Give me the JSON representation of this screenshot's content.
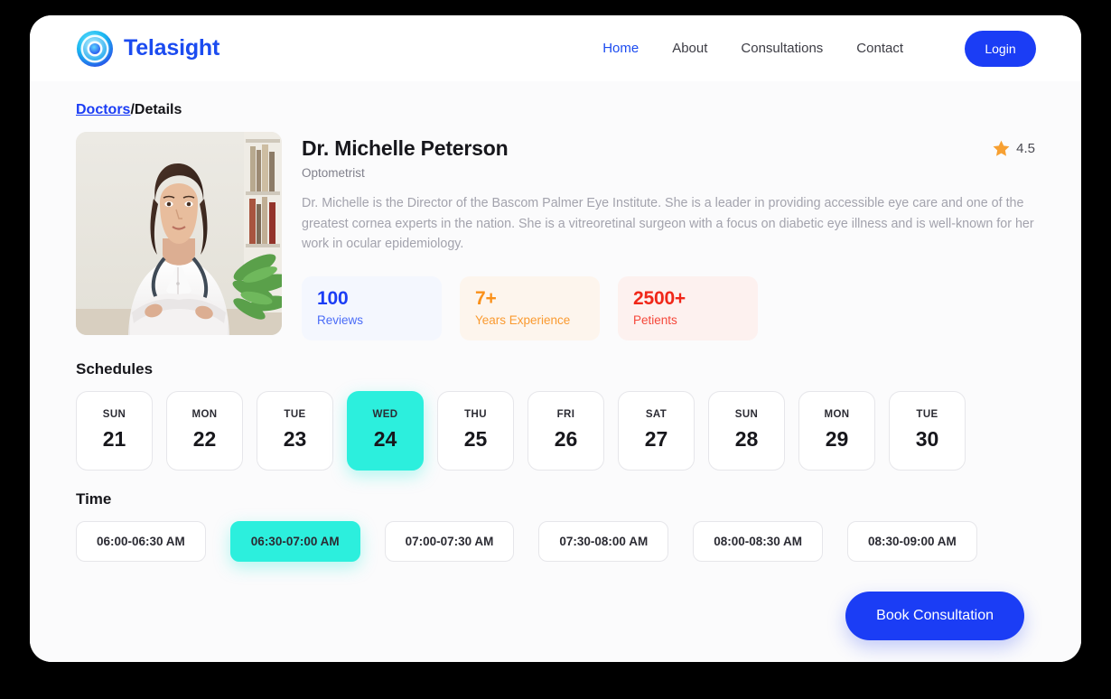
{
  "header": {
    "brand_name": "Telasight",
    "logo_icon": "concentric-circles-icon",
    "nav": [
      {
        "label": "Home",
        "active": true
      },
      {
        "label": "About",
        "active": false
      },
      {
        "label": "Consultations",
        "active": false
      },
      {
        "label": "Contact",
        "active": false
      }
    ],
    "login_label": "Login"
  },
  "breadcrumb": {
    "link_label": "Doctors",
    "separator_and_current": "/Details"
  },
  "doctor": {
    "photo_alt": "female-doctor-portrait",
    "name": "Dr. Michelle Peterson",
    "role": "Optometrist",
    "rating_value": "4.5",
    "rating_icon": "star-icon",
    "bio": "Dr. Michelle is the Director of the Bascom Palmer Eye Institute. She is a leader in providing accessible eye care and one of the greatest cornea experts in the nation. She is a vitreoretinal surgeon with a focus on diabetic eye illness and is well-known for her work in ocular epidemiology.",
    "stats": [
      {
        "value": "100",
        "label": "Reviews"
      },
      {
        "value": "7+",
        "label": "Years Experience"
      },
      {
        "value": "2500+",
        "label": "Petients"
      }
    ]
  },
  "schedules": {
    "title": "Schedules",
    "dates": [
      {
        "dow": "SUN",
        "day": "21",
        "selected": false
      },
      {
        "dow": "MON",
        "day": "22",
        "selected": false
      },
      {
        "dow": "TUE",
        "day": "23",
        "selected": false
      },
      {
        "dow": "WED",
        "day": "24",
        "selected": true
      },
      {
        "dow": "THU",
        "day": "25",
        "selected": false
      },
      {
        "dow": "FRI",
        "day": "26",
        "selected": false
      },
      {
        "dow": "SAT",
        "day": "27",
        "selected": false
      },
      {
        "dow": "SUN",
        "day": "28",
        "selected": false
      },
      {
        "dow": "MON",
        "day": "29",
        "selected": false
      },
      {
        "dow": "TUE",
        "day": "30",
        "selected": false
      }
    ]
  },
  "time": {
    "title": "Time",
    "slots": [
      {
        "label": "06:00-06:30 AM",
        "selected": false
      },
      {
        "label": "06:30-07:00 AM",
        "selected": true
      },
      {
        "label": "07:00-07:30 AM",
        "selected": false
      },
      {
        "label": "07:30-08:00 AM",
        "selected": false
      },
      {
        "label": "08:00-08:30 AM",
        "selected": false
      },
      {
        "label": "08:30-09:00 AM",
        "selected": false
      }
    ]
  },
  "actions": {
    "book_label": "Book Consultation"
  },
  "colors": {
    "brand_blue": "#1b3df5",
    "accent_teal": "#2cefdd",
    "rating_star": "#f7a032",
    "stat_reviews": "#1b3df5",
    "stat_experience": "#fa9019",
    "stat_patients": "#f02719",
    "page_background": "#000000",
    "content_background": "#fbfbfc"
  }
}
